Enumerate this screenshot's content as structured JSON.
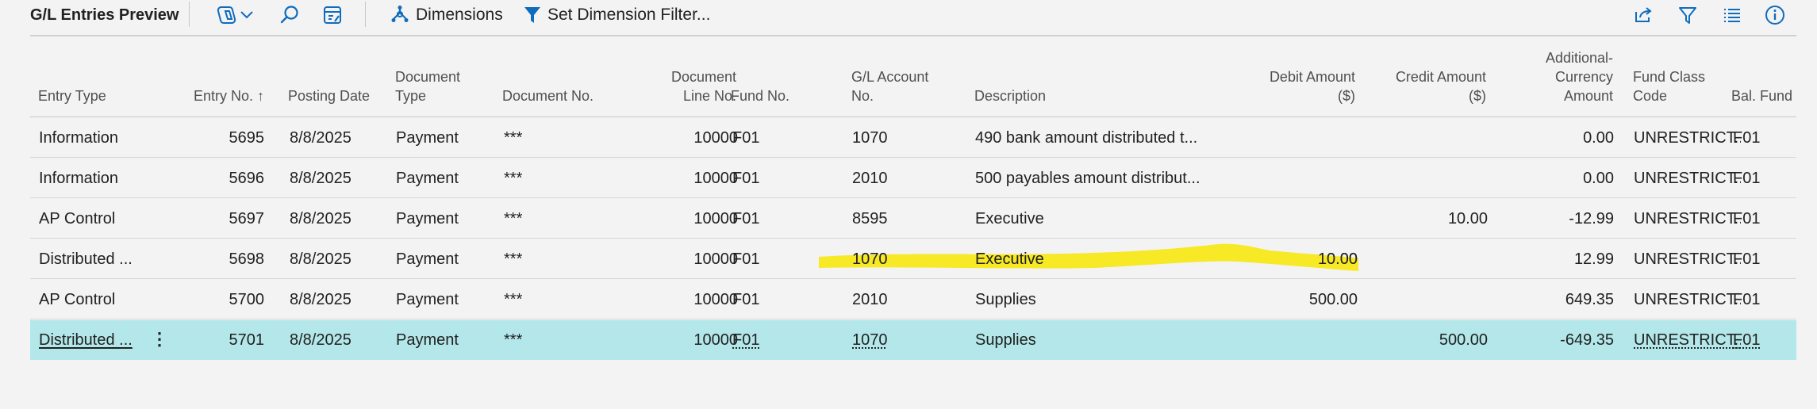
{
  "page": {
    "title": "G/L Entries Preview"
  },
  "toolbar": {
    "copilot_icon": "copilot-icon",
    "chevron_icon": "chevron-down-icon",
    "search_icon": "search-icon",
    "edit_list_icon": "edit-list-icon",
    "dimensions_label": "Dimensions",
    "set_filter_label": "Set Dimension Filter...",
    "share_icon": "share-icon",
    "filter_icon": "filter-icon",
    "list_view_icon": "list-view-icon",
    "info_icon": "info-icon"
  },
  "columns": {
    "entry_type": "Entry Type",
    "entry_no": "Entry No. ↑",
    "posting_date": "Posting Date",
    "document_type_1": "Document",
    "document_type_2": "Type",
    "document_no": "Document No.",
    "doc_line_1": "Document",
    "doc_line_2": "Line No.",
    "fund_no": "Fund No.",
    "gl_account_1": "G/L Account",
    "gl_account_2": "No.",
    "description": "Description",
    "debit_1": "Debit Amount",
    "debit_2": "($)",
    "credit_1": "Credit Amount",
    "credit_2": "($)",
    "addl_1": "Additional-",
    "addl_2": "Currency",
    "addl_3": "Amount",
    "fund_class_1": "Fund Class",
    "fund_class_2": "Code",
    "bal_fund": "Bal. Fund N"
  },
  "rows": [
    {
      "entry_type": "Information",
      "entry_no": "5695",
      "posting_date": "8/8/2025",
      "document_type": "Payment",
      "document_no": "***",
      "doc_line_no": "10000",
      "fund_no": "F01",
      "gl_account_no": "1070",
      "description": "490 bank amount distributed t...",
      "debit": "",
      "credit": "",
      "addl_amount": "0.00",
      "fund_class": "UNRESTRICT...",
      "bal_fund": "F01"
    },
    {
      "entry_type": "Information",
      "entry_no": "5696",
      "posting_date": "8/8/2025",
      "document_type": "Payment",
      "document_no": "***",
      "doc_line_no": "10000",
      "fund_no": "F01",
      "gl_account_no": "2010",
      "description": "500 payables amount distribut...",
      "debit": "",
      "credit": "",
      "addl_amount": "0.00",
      "fund_class": "UNRESTRICT...",
      "bal_fund": "F01"
    },
    {
      "entry_type": "AP Control",
      "entry_no": "5697",
      "posting_date": "8/8/2025",
      "document_type": "Payment",
      "document_no": "***",
      "doc_line_no": "10000",
      "fund_no": "F01",
      "gl_account_no": "8595",
      "description": "Executive",
      "debit": "",
      "credit": "10.00",
      "addl_amount": "-12.99",
      "fund_class": "UNRESTRICT...",
      "bal_fund": "F01"
    },
    {
      "entry_type": "Distributed ...",
      "entry_no": "5698",
      "posting_date": "8/8/2025",
      "document_type": "Payment",
      "document_no": "***",
      "doc_line_no": "10000",
      "fund_no": "F01",
      "gl_account_no": "1070",
      "description": "Executive",
      "debit": "10.00",
      "credit": "",
      "addl_amount": "12.99",
      "fund_class": "UNRESTRICT...",
      "bal_fund": "F01"
    },
    {
      "entry_type": "AP Control",
      "entry_no": "5700",
      "posting_date": "8/8/2025",
      "document_type": "Payment",
      "document_no": "***",
      "doc_line_no": "10000",
      "fund_no": "F01",
      "gl_account_no": "2010",
      "description": "Supplies",
      "debit": "500.00",
      "credit": "",
      "addl_amount": "649.35",
      "fund_class": "UNRESTRICT...",
      "bal_fund": "F01"
    },
    {
      "entry_type": "Distributed ...",
      "entry_no": "5701",
      "posting_date": "8/8/2025",
      "document_type": "Payment",
      "document_no": "***",
      "doc_line_no": "10000",
      "fund_no": "F01",
      "gl_account_no": "1070",
      "description": "Supplies",
      "debit": "",
      "credit": "500.00",
      "addl_amount": "-649.35",
      "fund_class": "UNRESTRICT...",
      "bal_fund": "F01"
    }
  ],
  "selection": {
    "selected_row": 5,
    "row_menu_icon": "more-vertical-icon"
  },
  "annotation": {
    "highlight_color": "#f7e600"
  },
  "colors": {
    "accent": "#0f6cbd",
    "selected_row": "#b3e7ea",
    "background": "#f3f3f4"
  }
}
